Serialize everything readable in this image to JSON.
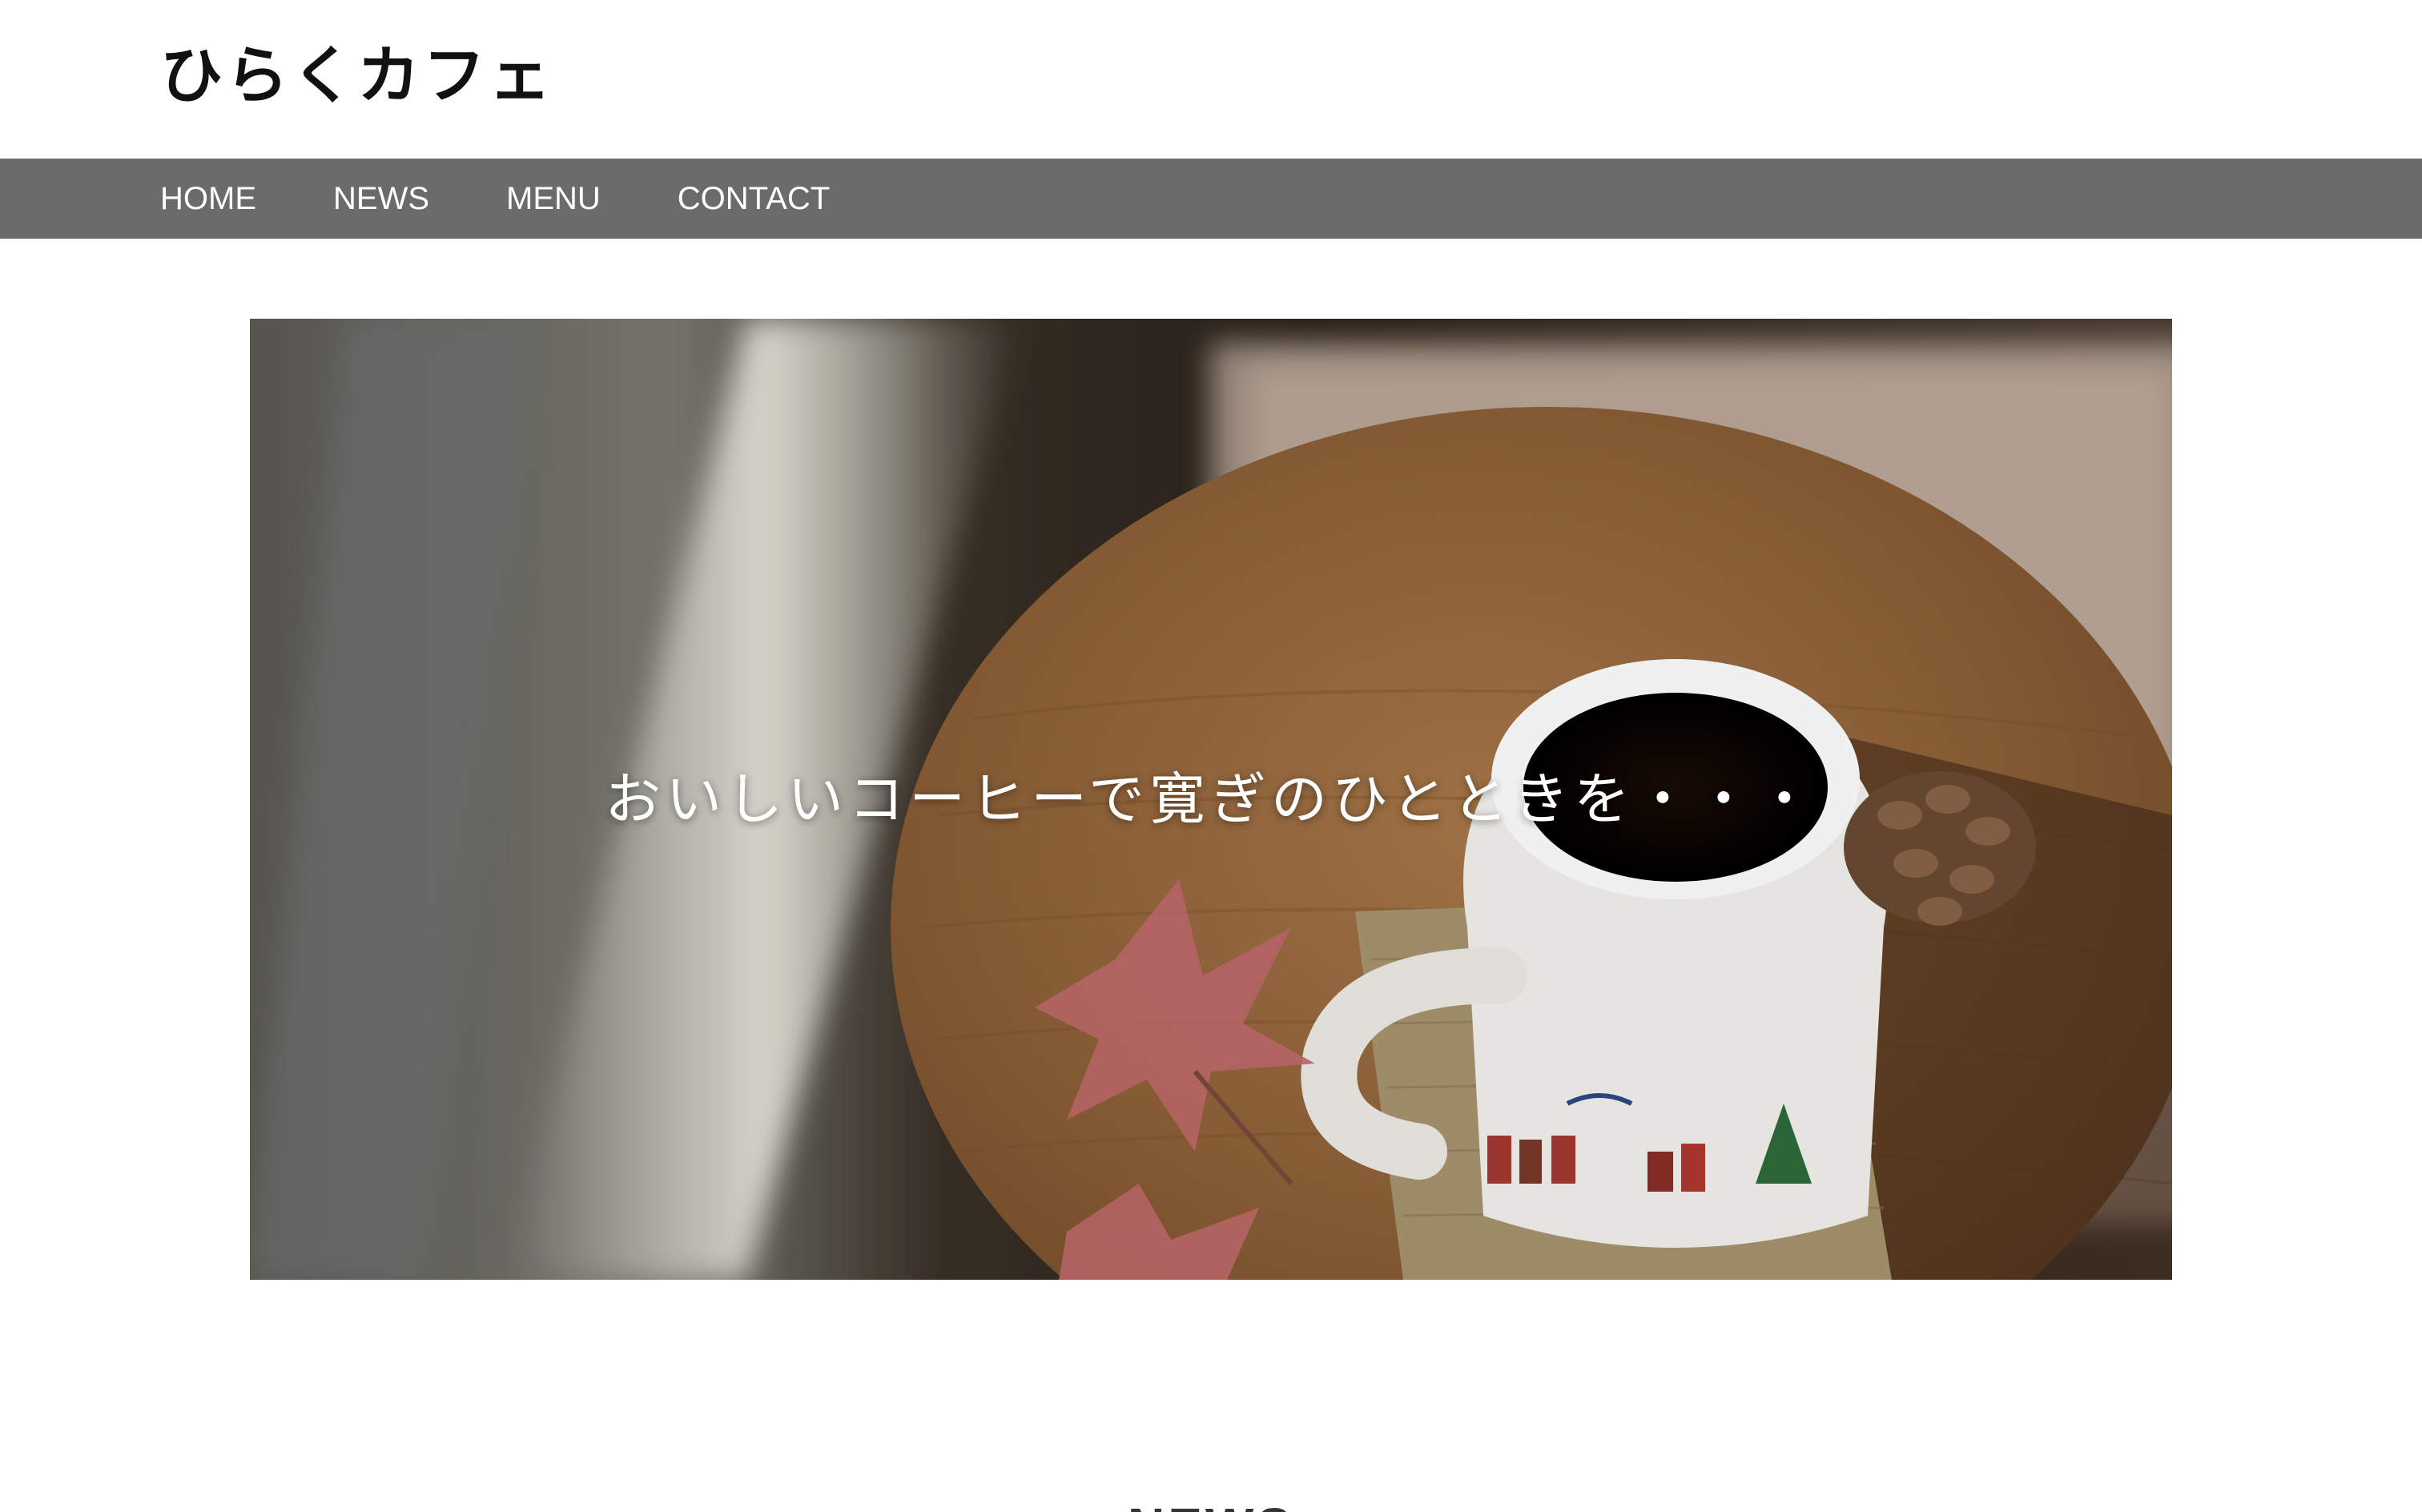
{
  "header": {
    "site_title": "ひらくカフェ"
  },
  "nav": {
    "items": [
      {
        "label": "HOME"
      },
      {
        "label": "NEWS"
      },
      {
        "label": "MENU"
      },
      {
        "label": "CONTACT"
      }
    ]
  },
  "hero": {
    "caption": "おいしいコーヒーで寛ぎのひとときを・・・"
  },
  "next_section": {
    "heading": "NEWS"
  },
  "colors": {
    "nav_background": "#6b6b6b",
    "nav_text": "#ffffff",
    "title_text": "#111111",
    "page_background": "#ffffff"
  }
}
